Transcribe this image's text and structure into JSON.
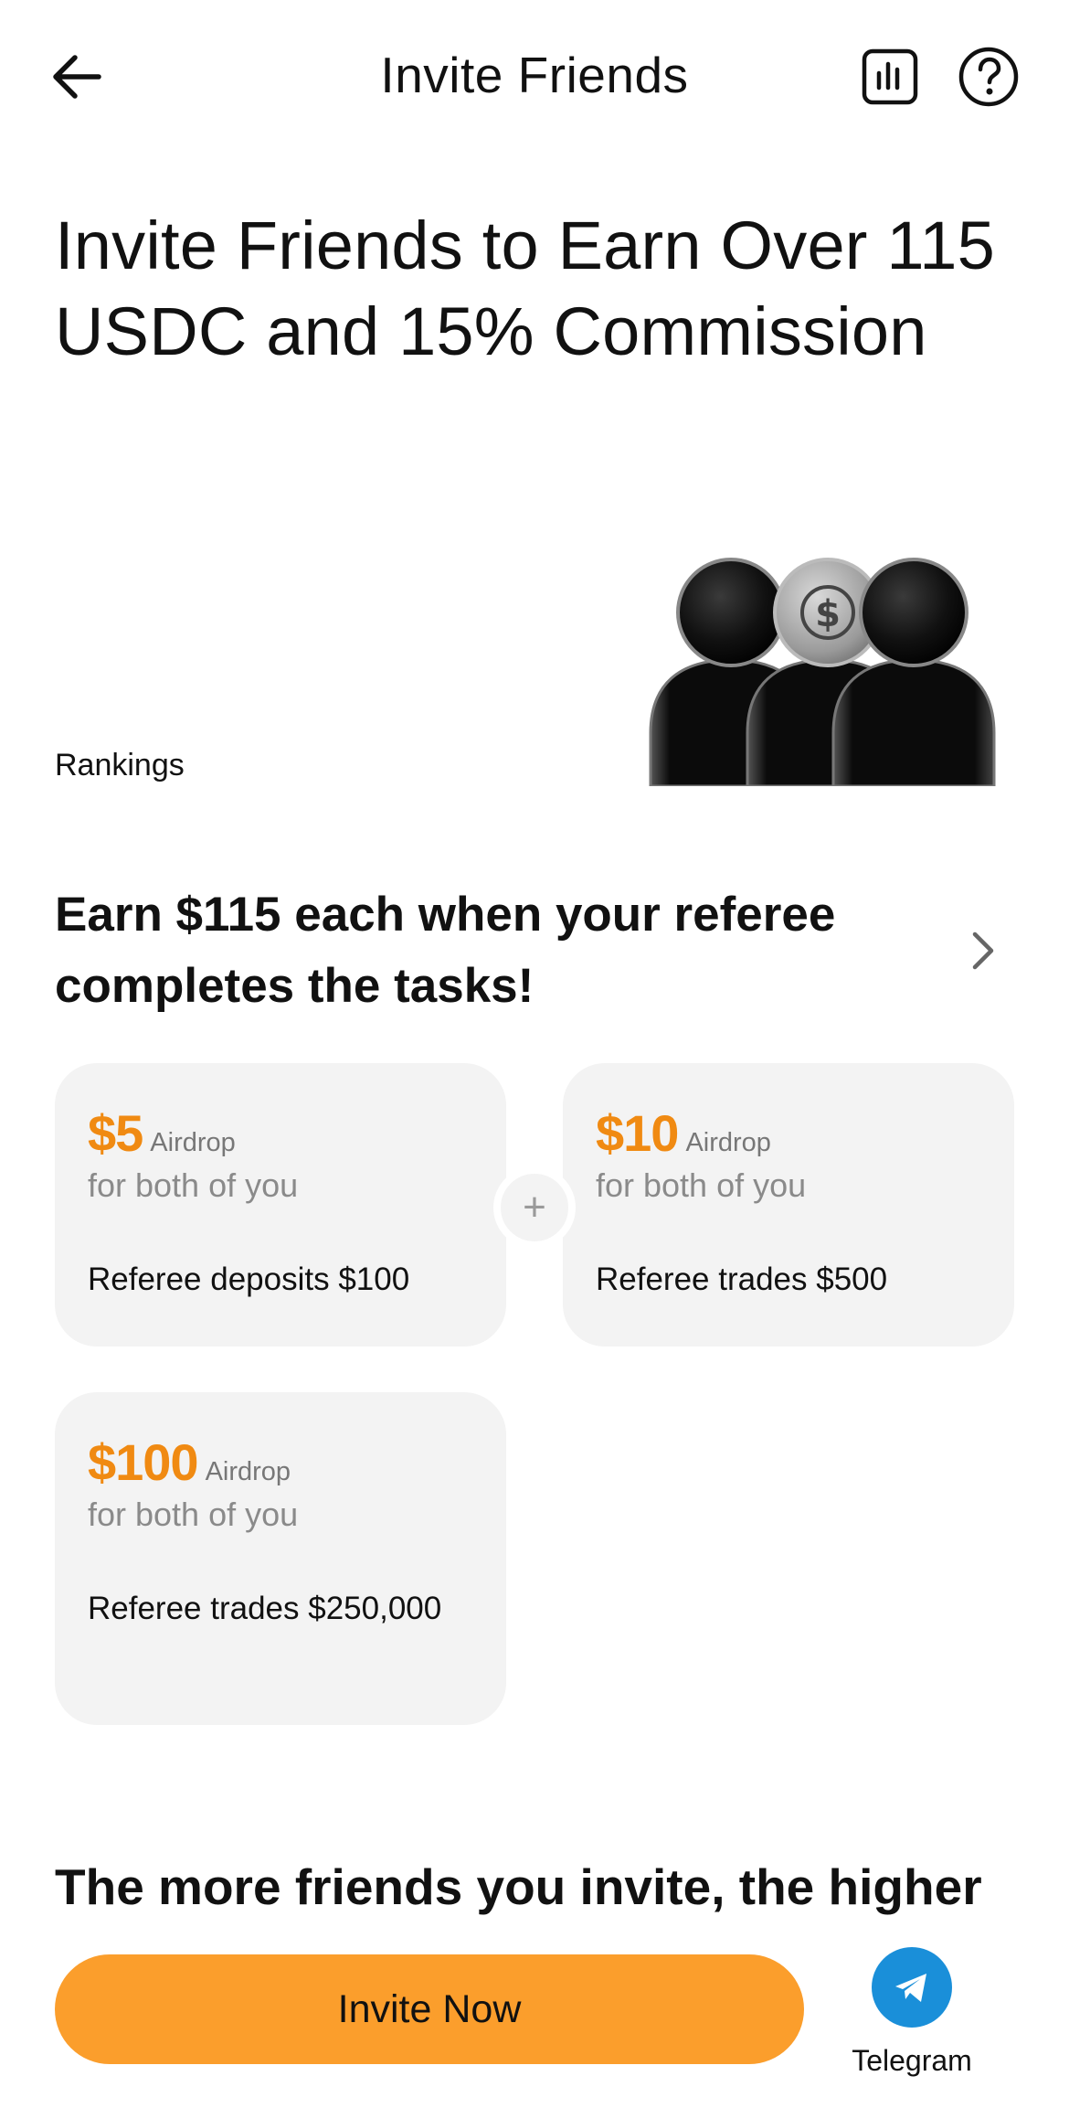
{
  "header": {
    "title": "Invite Friends",
    "back_icon": "arrow-left-icon",
    "stats_icon": "bar-chart-icon",
    "help_icon": "question-circle-icon"
  },
  "hero": {
    "title": "Invite Friends to Earn Over 115 USDC and 15% Commission",
    "rankings_label": "Rankings",
    "art": "referral-people-usdc-illustration"
  },
  "tasks_section": {
    "title": "Earn $115 each when your referee completes the tasks!",
    "cards": [
      {
        "amount": "$5",
        "reward_type": "Airdrop",
        "subtitle": "for both of you",
        "task": "Referee deposits $100"
      },
      {
        "amount": "$10",
        "reward_type": "Airdrop",
        "subtitle": "for both of you",
        "task": "Referee trades $500"
      },
      {
        "amount": "$100",
        "reward_type": "Airdrop",
        "subtitle": "for both of you",
        "task": "Referee trades $250,000"
      }
    ],
    "plus_symbol": "+"
  },
  "teaser_title": "The more friends you invite, the higher",
  "bottom_bar": {
    "invite_label": "Invite Now",
    "telegram_label": "Telegram",
    "telegram_icon": "telegram-icon"
  },
  "colors": {
    "accent_orange": "#fb9e2c",
    "amount_orange": "#f08a12",
    "card_bg": "#f3f3f3",
    "telegram_blue": "#1a8fd9"
  }
}
